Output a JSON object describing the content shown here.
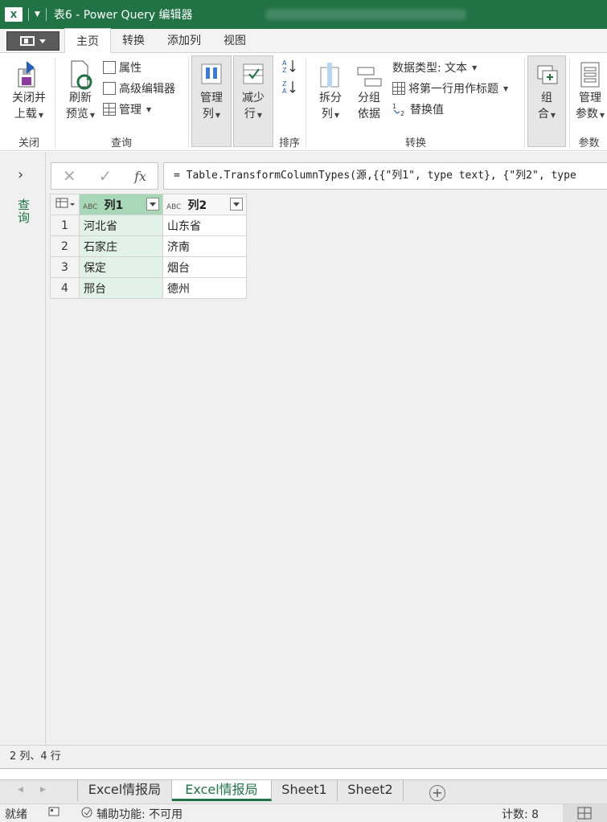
{
  "window": {
    "app_logo": "X",
    "title": "表6 - Power Query 编辑器"
  },
  "ribbon_tabs": [
    "主页",
    "转换",
    "添加列",
    "视图"
  ],
  "ribbon": {
    "groups": {
      "close": "关闭",
      "query": "查询",
      "sort": "排序",
      "transform": "转换",
      "params": "参数"
    },
    "close_load": [
      "关闭并",
      "上载"
    ],
    "refresh": [
      "刷新",
      "预览"
    ],
    "properties": "属性",
    "advanced_editor": "高级编辑器",
    "manage": "管理",
    "manage_cols": [
      "管理",
      "列"
    ],
    "reduce_rows": [
      "减少",
      "行"
    ],
    "split_col": [
      "拆分",
      "列"
    ],
    "group_by": [
      "分组",
      "依据"
    ],
    "data_type": "数据类型: 文本",
    "first_row_header": "将第一行用作标题",
    "replace_values": "替换值",
    "combine": [
      "组",
      "合"
    ],
    "manage_params": [
      "管理",
      "参数"
    ]
  },
  "side": {
    "queries_label": "查询"
  },
  "formula": "= Table.TransformColumnTypes(源,{{\"列1\", type text}, {\"列2\", type",
  "table": {
    "type_icon": "ABC",
    "columns": [
      "列1",
      "列2"
    ],
    "rows": [
      [
        "1",
        "河北省",
        "山东省"
      ],
      [
        "2",
        "石家庄",
        "济南"
      ],
      [
        "3",
        "保定",
        "烟台"
      ],
      [
        "4",
        "邢台",
        "德州"
      ]
    ]
  },
  "query_status": "2 列、4 行",
  "sheet_tabs": [
    "Excel情报局",
    "Excel情报局",
    "Sheet1",
    "Sheet2"
  ],
  "status": {
    "ready": "就绪",
    "accessibility": "辅助功能: 不可用",
    "count": "计数: 8"
  },
  "colors": {
    "accent": "#217346",
    "selected_col_header": "#a9d8b8",
    "selected_col_cells": "#e3f2e8"
  }
}
